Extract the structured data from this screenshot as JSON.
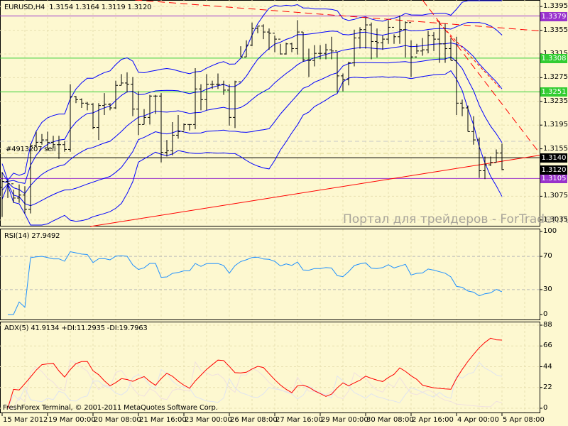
{
  "header": {
    "symbol": "EURUSD,H4",
    "ohlc": "1.3154 1.3164 1.3119 1.3120"
  },
  "trade_label": "#4913207 sell",
  "watermark": "Портал для трейдеров - ForTrader.ru",
  "copyright": "FreshForex Terminal, © 2001-2011 MetaQuotes Software Corp.",
  "colors": {
    "background": "#fdf8d0",
    "bars": "#000000",
    "bands": "#0000ff",
    "trend": "#ff0000",
    "rsi": "#1e90ff",
    "adx": "#ff0000",
    "purple": "#9932cc",
    "green": "#32cd32"
  },
  "chart_data": [
    {
      "type": "ohlc",
      "title": "EURUSD,H4",
      "ylim": [
        1.3024,
        1.3406
      ],
      "yticks": [
        "1.3395",
        "1.3355",
        "1.3315",
        "1.3275",
        "1.3235",
        "1.3195",
        "1.3155",
        "1.3075",
        "1.3035"
      ],
      "first_open": 1.309,
      "high": [
        1.3116,
        1.3102,
        1.3086,
        1.3095,
        1.3092,
        1.3164,
        1.3184,
        1.318,
        1.3184,
        1.3177,
        1.3177,
        1.3168,
        1.3264,
        1.3244,
        1.324,
        1.3234,
        1.3232,
        1.3232,
        1.3249,
        1.3232,
        1.327,
        1.3281,
        1.3284,
        1.3276,
        1.3252,
        1.3222,
        1.3246,
        1.3246,
        1.3249,
        1.317,
        1.32,
        1.3212,
        1.3198,
        1.3196,
        1.3291,
        1.3264,
        1.3281,
        1.327,
        1.3282,
        1.327,
        1.3264,
        1.327,
        1.3328,
        1.3338,
        1.3368,
        1.3362,
        1.3365,
        1.3358,
        1.3346,
        1.3332,
        1.3334,
        1.3334,
        1.3372,
        1.3352,
        1.3324,
        1.333,
        1.333,
        1.3332,
        1.3344,
        1.3318,
        1.3282,
        1.3302,
        1.3356,
        1.336,
        1.3376,
        1.3368,
        1.3358,
        1.3346,
        1.3372,
        1.3348,
        1.338,
        1.337,
        1.3338,
        1.3332,
        1.3342,
        1.3354,
        1.3352,
        1.337,
        1.3366,
        1.3342,
        1.3344,
        1.3238,
        1.3228,
        1.321,
        1.3174,
        1.3142,
        1.3142,
        1.3154,
        1.3164
      ],
      "low": [
        1.304,
        1.3072,
        1.3064,
        1.3064,
        1.3046,
        1.3046,
        1.3158,
        1.3162,
        1.3154,
        1.3156,
        1.3138,
        1.315,
        1.315,
        1.3232,
        1.3224,
        1.322,
        1.3188,
        1.317,
        1.3212,
        1.322,
        1.3222,
        1.3262,
        1.325,
        1.321,
        1.3178,
        1.3196,
        1.3196,
        1.3214,
        1.3132,
        1.3142,
        1.3144,
        1.3172,
        1.3186,
        1.3186,
        1.3188,
        1.322,
        1.322,
        1.3256,
        1.3256,
        1.3246,
        1.3194,
        1.319,
        1.331,
        1.331,
        1.3328,
        1.335,
        1.334,
        1.3322,
        1.3318,
        1.3314,
        1.3314,
        1.3318,
        1.3314,
        1.3302,
        1.3276,
        1.3294,
        1.3306,
        1.3306,
        1.3306,
        1.325,
        1.3252,
        1.3262,
        1.3294,
        1.3324,
        1.3324,
        1.3306,
        1.3309,
        1.3322,
        1.3332,
        1.3332,
        1.3332,
        1.3309,
        1.3276,
        1.3315,
        1.3312,
        1.3316,
        1.332,
        1.33,
        1.33,
        1.3304,
        1.3212,
        1.321,
        1.3184,
        1.3162,
        1.3106,
        1.3104,
        1.3126,
        1.3132,
        1.3119
      ],
      "close": [
        1.31,
        1.3096,
        1.3072,
        1.3077,
        1.3053,
        1.3161,
        1.3166,
        1.317,
        1.3166,
        1.3162,
        1.3162,
        1.3154,
        1.3243,
        1.3238,
        1.3232,
        1.323,
        1.3191,
        1.3228,
        1.323,
        1.3224,
        1.3262,
        1.3266,
        1.3264,
        1.3222,
        1.3196,
        1.3208,
        1.3244,
        1.3244,
        1.3149,
        1.3152,
        1.3178,
        1.3184,
        1.3196,
        1.3196,
        1.3256,
        1.3238,
        1.3264,
        1.3264,
        1.3264,
        1.3254,
        1.3208,
        1.3268,
        1.331,
        1.333,
        1.3358,
        1.3362,
        1.3352,
        1.335,
        1.334,
        1.3315,
        1.3332,
        1.3324,
        1.3352,
        1.3305,
        1.3304,
        1.3316,
        1.3316,
        1.3322,
        1.332,
        1.3278,
        1.3272,
        1.33,
        1.3342,
        1.3356,
        1.3364,
        1.3336,
        1.3334,
        1.334,
        1.336,
        1.3344,
        1.3356,
        1.3368,
        1.331,
        1.332,
        1.3322,
        1.3346,
        1.334,
        1.3332,
        1.3324,
        1.3304,
        1.3232,
        1.3224,
        1.3184,
        1.317,
        1.3118,
        1.3128,
        1.3132,
        1.3148,
        1.312
      ],
      "levels": [
        {
          "price": 1.3379,
          "label": "1.3379",
          "color": "#9932cc",
          "text": "#ffffff"
        },
        {
          "price": 1.3308,
          "label": "1.3308",
          "color": "#32cd32",
          "text": "#ffffff"
        },
        {
          "price": 1.3251,
          "label": "1.3251",
          "color": "#32cd32",
          "text": "#ffffff"
        },
        {
          "price": 1.314,
          "label": "1.3140",
          "color": "#000000",
          "text": "#ffffff"
        },
        {
          "price": 1.3105,
          "label": "1.3105",
          "color": "#9932cc",
          "text": "#ffffff"
        }
      ],
      "bid": {
        "price": 1.312,
        "label": "1.3120"
      },
      "trendlines": [
        {
          "from": [
            15.5,
            1.3024
          ],
          "to": [
            94.6,
            1.3144
          ],
          "style": "solid"
        },
        {
          "from": [
            23.4,
            1.3406
          ],
          "to": [
            94.6,
            1.3354
          ],
          "style": "dashed"
        },
        {
          "from": [
            74.0,
            1.3406
          ],
          "to": [
            94.6,
            1.3148
          ],
          "style": "dashed"
        },
        {
          "from": [
            76.5,
            1.3372
          ],
          "to": [
            87.8,
            1.3256
          ],
          "style": "dotted"
        }
      ],
      "xticks": [
        {
          "index": 0,
          "label": "15 Mar 2012"
        },
        {
          "index": 8,
          "label": "19 Mar 00:00"
        },
        {
          "index": 16,
          "label": "20 Mar 08:00"
        },
        {
          "index": 24,
          "label": "21 Mar 16:00"
        },
        {
          "index": 32,
          "label": "23 Mar 00:00"
        },
        {
          "index": 40,
          "label": "26 Mar 08:00"
        },
        {
          "index": 48,
          "label": "27 Mar 16:00"
        },
        {
          "index": 56,
          "label": "29 Mar 00:00"
        },
        {
          "index": 64,
          "label": "30 Mar 08:00"
        },
        {
          "index": 72,
          "label": "2 Apr 16:00"
        },
        {
          "index": 80,
          "label": "4 Apr 00:00"
        },
        {
          "index": 88,
          "label": "5 Apr 08:00"
        }
      ]
    },
    {
      "type": "line",
      "title": "RSI(14) 27.9492",
      "ylim": [
        0,
        100
      ],
      "yticks": [
        "100",
        "70",
        "30",
        "0"
      ],
      "levels": [
        70,
        30
      ]
    },
    {
      "type": "line",
      "title": "ADX(5) 41.9134 +DI:11.2935 -DI:19.7963",
      "ylim": [
        0,
        88
      ],
      "yticks": [
        "88",
        "66",
        "44",
        "22",
        "0"
      ]
    }
  ]
}
